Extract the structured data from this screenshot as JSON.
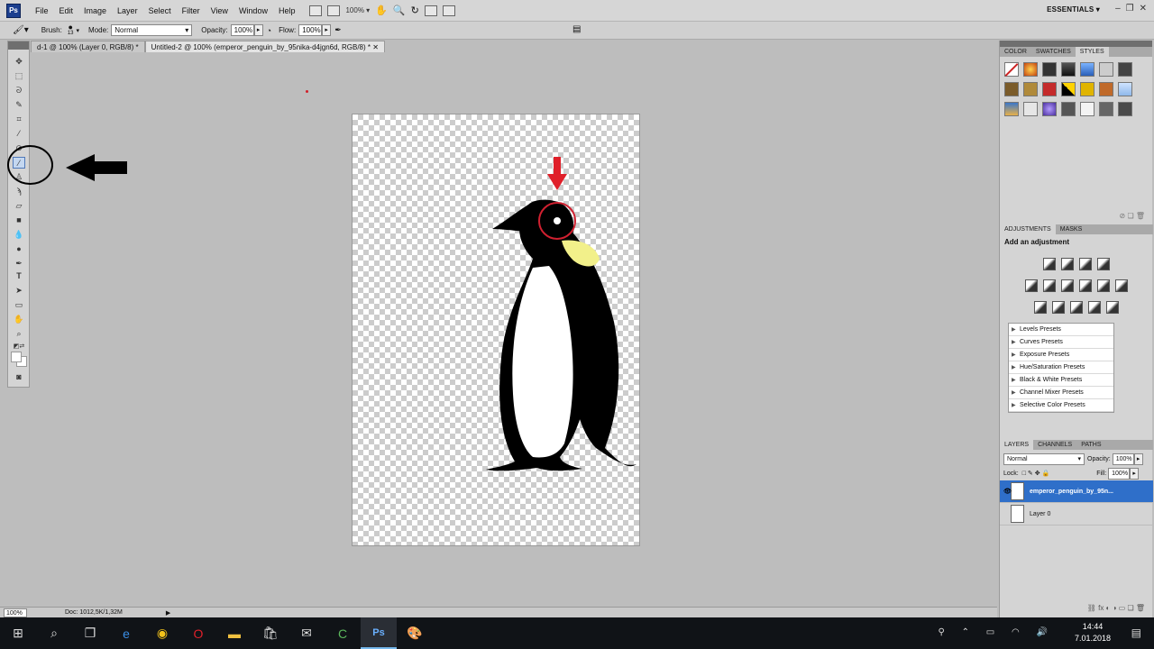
{
  "app": {
    "logo_text": "Ps",
    "workspace": "ESSENTIALS",
    "zoom_menu": "100%"
  },
  "menu": [
    "File",
    "Edit",
    "Image",
    "Layer",
    "Select",
    "Filter",
    "View",
    "Window",
    "Help"
  ],
  "options": {
    "brush_label": "Brush:",
    "brush_size": "13",
    "mode_label": "Mode:",
    "mode_value": "Normal",
    "opacity_label": "Opacity:",
    "opacity_value": "100%",
    "flow_label": "Flow:",
    "flow_value": "100%"
  },
  "tabs": [
    {
      "label": "d-1 @ 100% (Layer 0, RGB/8) *"
    },
    {
      "label": "Untitled-2 @ 100% (emperor_penguin_by_95nika-d4jgn6d, RGB/8) *"
    }
  ],
  "status": {
    "zoom": "100%",
    "doc": "Doc: 1012,5K/1,32M"
  },
  "panels": {
    "top_tabs": [
      "COLOR",
      "SWATCHES",
      "STYLES"
    ],
    "adjustments_tabs": [
      "ADJUSTMENTS",
      "MASKS"
    ],
    "adjustments_title": "Add an adjustment",
    "presets": [
      "Levels Presets",
      "Curves Presets",
      "Exposure Presets",
      "Hue/Saturation Presets",
      "Black & White Presets",
      "Channel Mixer Presets",
      "Selective Color Presets"
    ],
    "layers_tabs": [
      "LAYERS",
      "CHANNELS",
      "PATHS"
    ],
    "blend_mode": "Normal",
    "opacity_label": "Opacity:",
    "opacity_value": "100%",
    "lock_label": "Lock:",
    "fill_label": "Fill:",
    "fill_value": "100%",
    "layers": [
      {
        "name": "emperor_penguin_by_95n...",
        "selected": true,
        "visible": true
      },
      {
        "name": "Layer 0",
        "selected": false,
        "visible": false
      }
    ]
  },
  "taskbar": {
    "time": "14:44",
    "date": "7.01.2018"
  }
}
